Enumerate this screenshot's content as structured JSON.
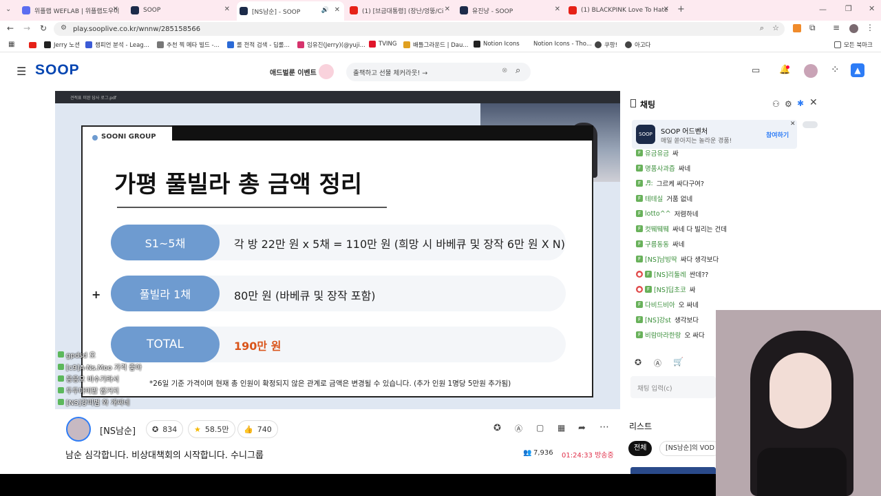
{
  "browser": {
    "tabs": [
      {
        "title": "위플랩 WEFLAB | 위플랩도우미"
      },
      {
        "title": "SOOP"
      },
      {
        "title": "[NS남순] - SOOP"
      },
      {
        "title": "(1) [브금대통령] (장난/엉뚱/Ci"
      },
      {
        "title": "유진냥 - SOOP"
      },
      {
        "title": "(1) BLACKPINK Love To Hate"
      }
    ],
    "url": "play.sooplive.co.kr/wnnw/285158566",
    "bookmarks": [
      "Jerry 노션",
      "챔피언 분석 - Leag...",
      "추천 찍 메타 빌드 -...",
      "롤 전적 검색 - 딥롤...",
      "임유진(Jerry)(@yuji...",
      "TVING",
      "배틀그라운드 | Dau...",
      "Notion Icons",
      "Notion Icons - Tho...",
      "쿠팡!",
      "아고다"
    ],
    "bookmarks_all": "모든 북마크"
  },
  "site": {
    "logo": "SOOP",
    "event_label": "애드벌룬 이벤트",
    "search_placeholder": "출책하고 선물 체커라웃! →"
  },
  "video": {
    "viewer_title": "견적표 미완 답사 로그.pdf",
    "slide": {
      "group": "SOONI GROUP",
      "title": "가평 풀빌라 총 금액 정리",
      "rows": [
        {
          "label": "S1~5채",
          "text": "각 방 22만 원 x 5채 = 110만 원 (희망 시 바베큐 및 장작 6만 원 X N)"
        },
        {
          "label": "풀빌라 1채",
          "text": "80만 원 (바베큐 및 장작 포함)"
        },
        {
          "label": "TOTAL",
          "text": "190만 원"
        }
      ],
      "plus": "+",
      "note": "*26일 기준 가격이며 현재 총 인원이 확정되지 않은 관계로 금액은 변경될 수 있습니다. (추가 인원 1명당 5만원 추가됨)"
    },
    "overlay_chat": [
      {
        "text": "gpdsd 오"
      },
      {
        "text": "[c9]A-Ns.Moo 가격 좋아"
      },
      {
        "text": "응응오 비수기라서"
      },
      {
        "text": "두두마미맙 쌉거지"
      },
      {
        "text": "[NS]강피범 와 개싸네"
      }
    ]
  },
  "stream": {
    "streamer": "[NS남순]",
    "bookmarks": "834",
    "stars": "58.5만",
    "likes": "740",
    "title": "남순 심각합니다. 비상대책회의 시작합니다. 수니그룹",
    "viewers": "7,936",
    "elapsed": "01:24:33 방송중"
  },
  "chat": {
    "header": "채팅",
    "ad": {
      "title": "SOOP 어드벤처",
      "sub": "매일 쏟아지는 놀라운 경품!",
      "cta": "참여하기"
    },
    "messages": [
      {
        "name": "유금유금",
        "text": "싸"
      },
      {
        "name": "명품사과즙",
        "text": "싸네"
      },
      {
        "name": "♬:",
        "text": "그르케 싸다구여?"
      },
      {
        "name": "테테실",
        "text": "거품 없네"
      },
      {
        "name": "lotto^^",
        "text": "저렴하네"
      },
      {
        "name": "컷뛔뛔뛔",
        "text": "싸네 다 빌리는 건데"
      },
      {
        "name": "구름동동",
        "text": "싸네"
      },
      {
        "name": "[NS]남빙딱",
        "text": "싸다 생각보다"
      },
      {
        "name": "[NS]리둘레",
        "text": "싼데??"
      },
      {
        "name": "[NS]딥초코",
        "text": "싸"
      },
      {
        "name": "다비드비아",
        "text": "오 싸네"
      },
      {
        "name": "[NS]강st",
        "text": "생각보다"
      },
      {
        "name": "비람마라한랑",
        "text": "오 싸다"
      }
    ],
    "input_placeholder": "채팅 입력(c)",
    "list_title": "리스트",
    "list_tabs": [
      "전체",
      "[NS남순]의 VOD"
    ]
  },
  "colors": {
    "accent": "#0545b1",
    "pill": "#6e9bd0",
    "total": "#d9541a",
    "tabbar": "#fdeaf0"
  }
}
